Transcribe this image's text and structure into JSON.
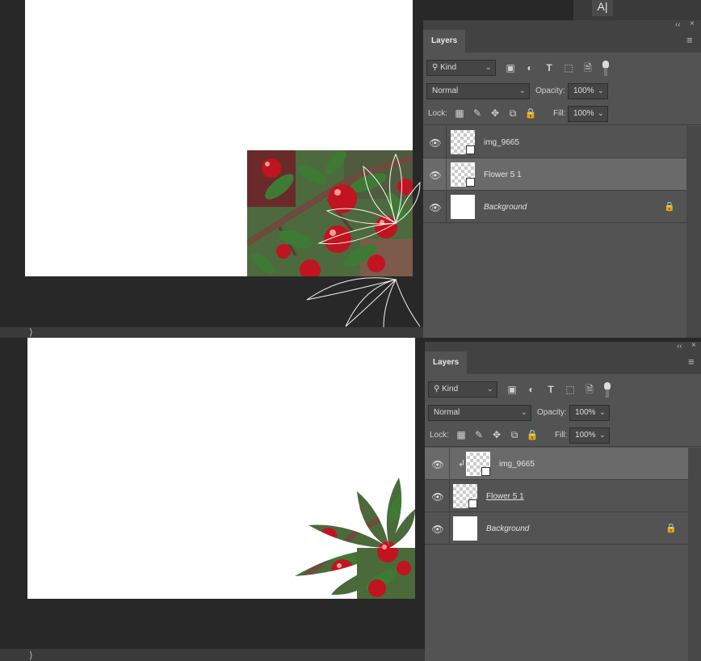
{
  "colors": {
    "workspace": "#282828",
    "panel": "#535353",
    "selected_row": "#6a6a6a",
    "cherry": "#c01421",
    "leaf": "#3f6a32"
  },
  "icons": {
    "eye": "eye-icon",
    "search": "search-icon",
    "image_filter": "image-filter-icon",
    "adjustment_filter": "adjustment-filter-icon",
    "type_filter": "type-filter-icon",
    "shape_filter": "shape-filter-icon",
    "smart_filter": "smart-object-filter-icon",
    "lock_transparent": "lock-transparent-pixels-icon",
    "lock_image": "lock-image-pixels-icon",
    "lock_position": "lock-position-icon",
    "lock_artboard": "artboard-lock-icon",
    "lock_all": "lock-all-icon",
    "clip": "clipping-arrow-icon",
    "type_tool": "type-tool-icon"
  },
  "top": {
    "type_tool_glyph": "A|",
    "statusbar_glyph": "⟩",
    "panel": {
      "collapse": "‹‹",
      "close": "×",
      "menu": "≡",
      "tab": "Layers",
      "filter_kind": "Kind",
      "blend_mode": "Normal",
      "opacity_label": "Opacity:",
      "opacity_value": "100%",
      "lock_label": "Lock:",
      "fill_label": "Fill:",
      "fill_value": "100%",
      "layers": [
        {
          "name": "img_9665",
          "italic": false,
          "underline": false,
          "selected": false,
          "clipped": false,
          "locked": false
        },
        {
          "name": "Flower 5 1",
          "italic": false,
          "underline": false,
          "selected": true,
          "clipped": false,
          "locked": false
        },
        {
          "name": "Background",
          "italic": true,
          "underline": false,
          "selected": false,
          "clipped": false,
          "locked": true
        }
      ]
    }
  },
  "bottom": {
    "statusbar_glyph": "⟩",
    "panel": {
      "collapse": "‹‹",
      "close": "×",
      "menu": "≡",
      "tab": "Layers",
      "filter_kind": "Kind",
      "blend_mode": "Normal",
      "opacity_label": "Opacity:",
      "opacity_value": "100%",
      "lock_label": "Lock:",
      "fill_label": "Fill:",
      "fill_value": "100%",
      "layers": [
        {
          "name": "img_9665",
          "italic": false,
          "underline": false,
          "selected": true,
          "clipped": true,
          "locked": false
        },
        {
          "name": "Flower 5 1",
          "italic": false,
          "underline": true,
          "selected": false,
          "clipped": false,
          "locked": false
        },
        {
          "name": "Background",
          "italic": true,
          "underline": false,
          "selected": false,
          "clipped": false,
          "locked": true
        }
      ]
    }
  }
}
